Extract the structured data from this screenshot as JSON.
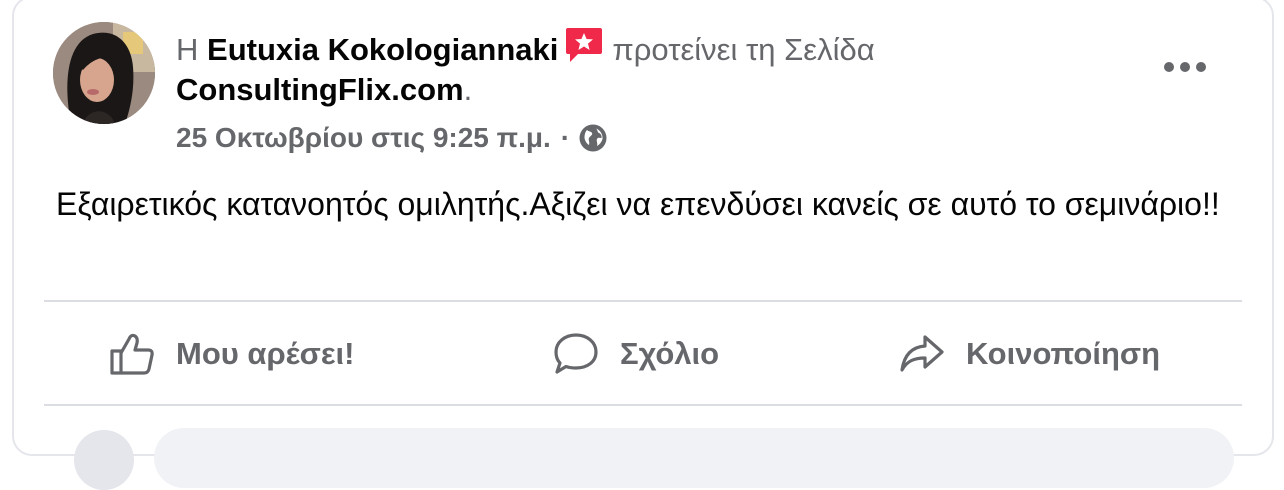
{
  "post": {
    "prefix": "Η",
    "author": "Eutuxia Kokologiannaki",
    "action_text": "προτείνει τη Σελίδα",
    "page_name": "ConsultingFlix.com",
    "page_suffix": ".",
    "timestamp": "25 Οκτωβρίου στις 9:25 π.μ.",
    "separator": "·",
    "body": "Εξαιρετικός κατανοητός ομιλητής.Αξιζει να επενδύσει κανείς σε αυτό το σεμινάριο!!"
  },
  "actions": {
    "like_label": "Μου αρέσει!",
    "comment_label": "Σχόλιο",
    "share_label": "Κοινοποίηση"
  },
  "icons": {
    "badge": "recommendation-star-icon",
    "privacy": "globe-icon",
    "more": "more-options-icon"
  },
  "colors": {
    "badge": "#f02849",
    "secondary_text": "#65676b",
    "primary_text": "#050505",
    "divider": "#dadde1"
  }
}
